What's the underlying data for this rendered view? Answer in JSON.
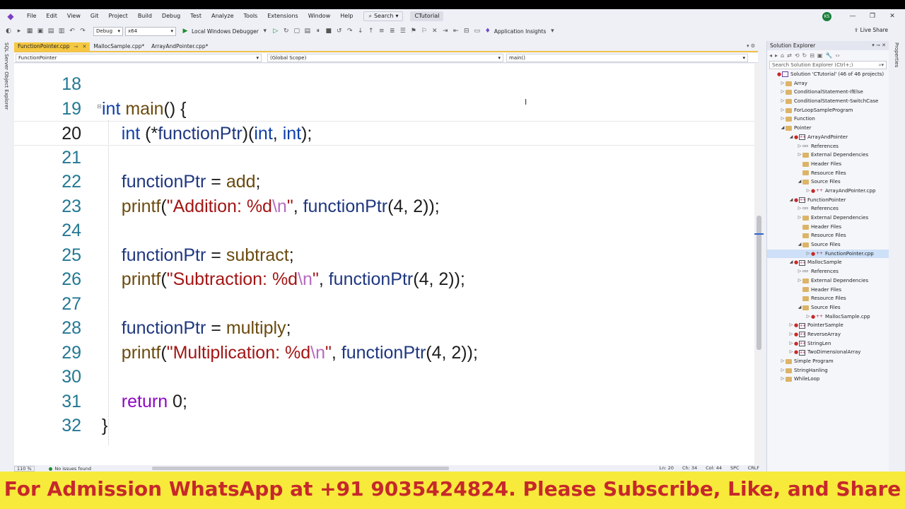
{
  "titlebar": {
    "menu": [
      "File",
      "Edit",
      "View",
      "Git",
      "Project",
      "Build",
      "Debug",
      "Test",
      "Analyze",
      "Tools",
      "Extensions",
      "Window",
      "Help"
    ],
    "search_label": "Search",
    "solution_name": "CTutorial",
    "avatar_initials": "KS"
  },
  "toolbar": {
    "config": "Debug",
    "platform": "x64",
    "run_label": "Local Windows Debugger",
    "insights_label": "Application Insights",
    "live_share": "Live Share"
  },
  "left_strip": {
    "label": "SQL Server Object Explorer"
  },
  "tabs": [
    {
      "label": "FunctionPointer.cpp",
      "active": true
    },
    {
      "label": "MallocSample.cpp*",
      "active": false
    },
    {
      "label": "ArrayAndPointer.cpp*",
      "active": false
    }
  ],
  "navbar": {
    "file": "FunctionPointer",
    "scope": "(Global Scope)",
    "member": "main()"
  },
  "code_lines": [
    {
      "n": "18",
      "parts": []
    },
    {
      "n": "19",
      "parts": [
        {
          "t": "int",
          "c": "kw"
        },
        {
          "t": " "
        },
        {
          "t": "main",
          "c": "fn"
        },
        {
          "t": "() {"
        }
      ]
    },
    {
      "n": "20",
      "parts": [
        {
          "t": "    "
        },
        {
          "t": "int",
          "c": "kw"
        },
        {
          "t": " (*"
        },
        {
          "t": "functionPtr",
          "c": "var"
        },
        {
          "t": ")("
        },
        {
          "t": "int",
          "c": "kw"
        },
        {
          "t": ", "
        },
        {
          "t": "int",
          "c": "kw"
        },
        {
          "t": ");"
        }
      ]
    },
    {
      "n": "21",
      "parts": []
    },
    {
      "n": "22",
      "parts": [
        {
          "t": "    "
        },
        {
          "t": "functionPtr",
          "c": "var"
        },
        {
          "t": " = "
        },
        {
          "t": "add",
          "c": "fn"
        },
        {
          "t": ";"
        }
      ]
    },
    {
      "n": "23",
      "parts": [
        {
          "t": "    "
        },
        {
          "t": "printf",
          "c": "fn"
        },
        {
          "t": "("
        },
        {
          "t": "\"Addition: %d",
          "c": "str"
        },
        {
          "t": "\\n",
          "c": "esc"
        },
        {
          "t": "\"",
          "c": "str"
        },
        {
          "t": ", "
        },
        {
          "t": "functionPtr",
          "c": "var"
        },
        {
          "t": "(4, 2));"
        }
      ]
    },
    {
      "n": "24",
      "parts": []
    },
    {
      "n": "25",
      "parts": [
        {
          "t": "    "
        },
        {
          "t": "functionPtr",
          "c": "var"
        },
        {
          "t": " = "
        },
        {
          "t": "subtract",
          "c": "fn"
        },
        {
          "t": ";"
        }
      ]
    },
    {
      "n": "26",
      "parts": [
        {
          "t": "    "
        },
        {
          "t": "printf",
          "c": "fn"
        },
        {
          "t": "("
        },
        {
          "t": "\"Subtraction: %d",
          "c": "str"
        },
        {
          "t": "\\n",
          "c": "esc"
        },
        {
          "t": "\"",
          "c": "str"
        },
        {
          "t": ", "
        },
        {
          "t": "functionPtr",
          "c": "var"
        },
        {
          "t": "(4, 2));"
        }
      ]
    },
    {
      "n": "27",
      "parts": []
    },
    {
      "n": "28",
      "parts": [
        {
          "t": "    "
        },
        {
          "t": "functionPtr",
          "c": "var"
        },
        {
          "t": " = "
        },
        {
          "t": "multiply",
          "c": "fn"
        },
        {
          "t": ";"
        }
      ]
    },
    {
      "n": "29",
      "parts": [
        {
          "t": "    "
        },
        {
          "t": "printf",
          "c": "fn"
        },
        {
          "t": "("
        },
        {
          "t": "\"Multiplication: %d",
          "c": "str"
        },
        {
          "t": "\\n",
          "c": "esc"
        },
        {
          "t": "\"",
          "c": "str"
        },
        {
          "t": ", "
        },
        {
          "t": "functionPtr",
          "c": "var"
        },
        {
          "t": "(4, 2));"
        }
      ]
    },
    {
      "n": "30",
      "parts": []
    },
    {
      "n": "31",
      "parts": [
        {
          "t": "    "
        },
        {
          "t": "return",
          "c": "ret"
        },
        {
          "t": " 0;"
        }
      ]
    },
    {
      "n": "32",
      "parts": [
        {
          "t": "}"
        }
      ]
    }
  ],
  "current_line": "20",
  "statusbar": {
    "zoom": "110 %",
    "issues": "No issues found",
    "ln": "Ln: 20",
    "ch": "Ch: 34",
    "col": "Col: 44",
    "spc": "SPC",
    "crlf": "CRLF"
  },
  "solution_explorer": {
    "title": "Solution Explorer",
    "search_placeholder": "Search Solution Explorer (Ctrl+;)",
    "nodes": [
      {
        "d": 0,
        "label": "Solution 'CTutorial' (46 of 46 projects)",
        "icon": "solution",
        "arrow": "",
        "dot": true
      },
      {
        "d": 1,
        "label": "Array",
        "icon": "folder",
        "arrow": "▷"
      },
      {
        "d": 1,
        "label": "ConditionalStatement-IfElse",
        "icon": "folder",
        "arrow": "▷"
      },
      {
        "d": 1,
        "label": "ConditionalStatement-SwitchCase",
        "icon": "folder",
        "arrow": "▷"
      },
      {
        "d": 1,
        "label": "ForLoopSampleProgram",
        "icon": "folder",
        "arrow": "▷"
      },
      {
        "d": 1,
        "label": "Function",
        "icon": "folder",
        "arrow": "▷"
      },
      {
        "d": 1,
        "label": "Pointer",
        "icon": "folder",
        "arrow": "◢"
      },
      {
        "d": 2,
        "label": "ArrayAndPointer",
        "icon": "project",
        "arrow": "◢",
        "dot": true
      },
      {
        "d": 3,
        "label": "References",
        "icon": "ref",
        "arrow": "▷"
      },
      {
        "d": 3,
        "label": "External Dependencies",
        "icon": "folder",
        "arrow": "▷"
      },
      {
        "d": 3,
        "label": "Header Files",
        "icon": "folder",
        "arrow": ""
      },
      {
        "d": 3,
        "label": "Resource Files",
        "icon": "folder",
        "arrow": ""
      },
      {
        "d": 3,
        "label": "Source Files",
        "icon": "folder",
        "arrow": "◢"
      },
      {
        "d": 4,
        "label": "ArrayAndPointer.cpp",
        "icon": "cpp",
        "arrow": "▷",
        "dot": true
      },
      {
        "d": 2,
        "label": "FunctionPointer",
        "icon": "project",
        "arrow": "◢",
        "dot": true
      },
      {
        "d": 3,
        "label": "References",
        "icon": "ref",
        "arrow": "▷"
      },
      {
        "d": 3,
        "label": "External Dependencies",
        "icon": "folder",
        "arrow": "▷"
      },
      {
        "d": 3,
        "label": "Header Files",
        "icon": "folder",
        "arrow": ""
      },
      {
        "d": 3,
        "label": "Resource Files",
        "icon": "folder",
        "arrow": ""
      },
      {
        "d": 3,
        "label": "Source Files",
        "icon": "folder",
        "arrow": "◢"
      },
      {
        "d": 4,
        "label": "FunctionPointer.cpp",
        "icon": "cpp",
        "arrow": "▷",
        "dot": true,
        "sel": true
      },
      {
        "d": 2,
        "label": "MallocSample",
        "icon": "project",
        "arrow": "◢",
        "dot": true
      },
      {
        "d": 3,
        "label": "References",
        "icon": "ref",
        "arrow": "▷"
      },
      {
        "d": 3,
        "label": "External Dependencies",
        "icon": "folder",
        "arrow": "▷"
      },
      {
        "d": 3,
        "label": "Header Files",
        "icon": "folder",
        "arrow": ""
      },
      {
        "d": 3,
        "label": "Resource Files",
        "icon": "folder",
        "arrow": ""
      },
      {
        "d": 3,
        "label": "Source Files",
        "icon": "folder",
        "arrow": "◢"
      },
      {
        "d": 4,
        "label": "MallocSample.cpp",
        "icon": "cpp",
        "arrow": "▷",
        "dot": true
      },
      {
        "d": 2,
        "label": "PointerSample",
        "icon": "project",
        "arrow": "▷",
        "dot": true
      },
      {
        "d": 2,
        "label": "ReverseArray",
        "icon": "project",
        "arrow": "▷",
        "dot": true
      },
      {
        "d": 2,
        "label": "StringLen",
        "icon": "project",
        "arrow": "▷",
        "dot": true
      },
      {
        "d": 2,
        "label": "TwoDimensionalArray",
        "icon": "project",
        "arrow": "▷",
        "dot": true
      },
      {
        "d": 1,
        "label": "Simple Program",
        "icon": "folder",
        "arrow": "▷"
      },
      {
        "d": 1,
        "label": "StringHanling",
        "icon": "folder",
        "arrow": "▷"
      },
      {
        "d": 1,
        "label": "WhileLoop",
        "icon": "folder",
        "arrow": "▷"
      }
    ]
  },
  "properties_strip": {
    "label": "Properties"
  },
  "banner": {
    "text": "For Admission WhatsApp at +91 9035424824. Please Subscribe, Like, and Share"
  }
}
